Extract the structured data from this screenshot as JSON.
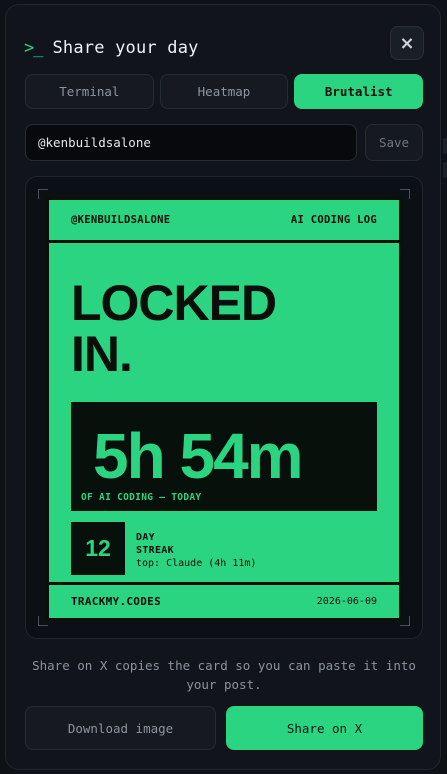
{
  "header": {
    "prompt_glyph": ">_",
    "title": "Share your day",
    "close_glyph": "×"
  },
  "tabs": [
    {
      "label": "Terminal",
      "active": false
    },
    {
      "label": "Heatmap",
      "active": false
    },
    {
      "label": "Brutalist",
      "active": true
    }
  ],
  "handle": {
    "value": "@kenbuildsalone",
    "save_label": "Save"
  },
  "card": {
    "handle": "@KENBUILDSALONE",
    "log_label": "AI CODING LOG",
    "headline_line1": "LOCKED",
    "headline_line2": "IN.",
    "time_value": "5h 54m",
    "time_caption": "OF AI CODING — TODAY",
    "streak_days": "12",
    "streak_label_1": "DAY",
    "streak_label_2": "STREAK",
    "top_tool": "top: Claude (4h 11m)",
    "brand": "TRACKMY.CODES",
    "date": "2026-06-09"
  },
  "hint": "Share on X copies the card so you can paste it into your post.",
  "actions": {
    "download_label": "Download image",
    "share_label": "Share on X"
  },
  "colors": {
    "accent": "#2bd481",
    "background": "#11151b",
    "ink": "#0b0f0c"
  }
}
